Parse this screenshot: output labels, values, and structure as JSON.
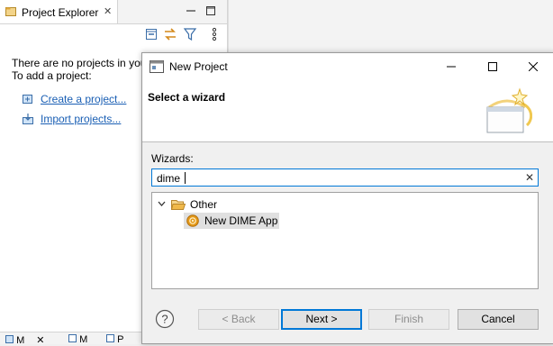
{
  "project_explorer": {
    "tab_label": "Project Explorer",
    "close_glyph": "✕",
    "message_line1": "There are no projects in your",
    "message_line2": "To add a project:",
    "links": [
      {
        "label": "Create a project...",
        "icon": "new-project-icon"
      },
      {
        "label": "Import projects...",
        "icon": "import-icon"
      }
    ],
    "toolbar_icons": [
      "collapse-all-icon",
      "link-with-editor-icon",
      "filter-icon",
      "view-menu-icon"
    ],
    "bottom_tabs": [
      "M",
      "M",
      "P"
    ]
  },
  "dialog": {
    "title": "New Project",
    "header_title": "Select a wizard",
    "wizards_label": "Wizards:",
    "search_value": "dime",
    "clear_glyph": "✕",
    "tree": {
      "category": "Other",
      "item": "New DIME App"
    },
    "buttons": {
      "back": "< Back",
      "next": "Next >",
      "finish": "Finish",
      "cancel": "Cancel"
    }
  },
  "colors": {
    "accent": "#0078d7",
    "link": "#1a5fb4",
    "folder": "#e0a63a",
    "dime": "#e59a1a"
  }
}
